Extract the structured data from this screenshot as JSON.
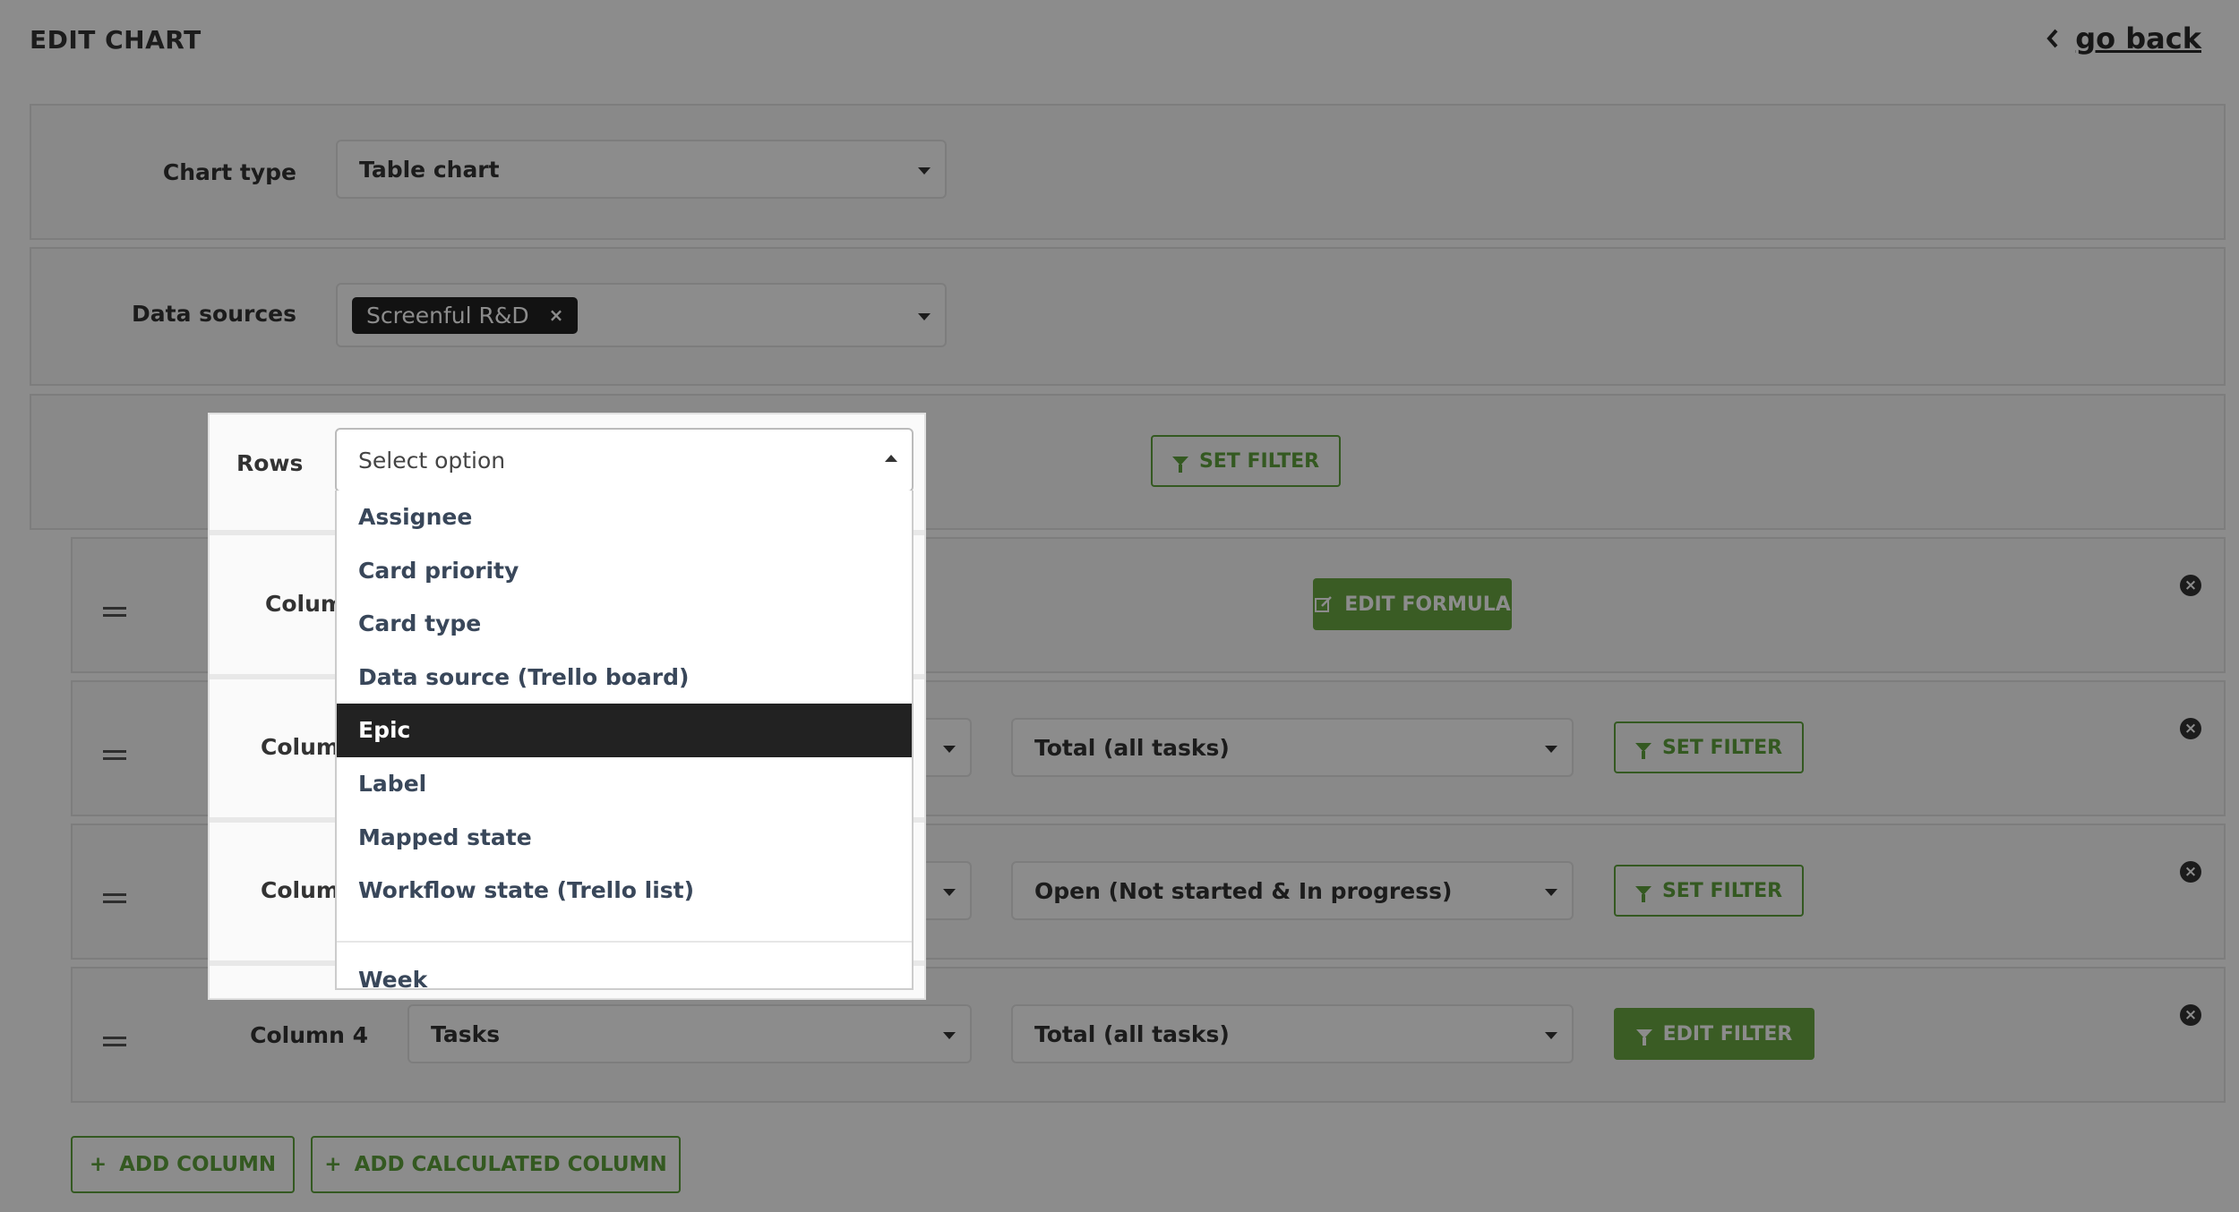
{
  "header": {
    "title": "EDIT CHART",
    "go_back": "go back"
  },
  "chart_type": {
    "label": "Chart type",
    "value": "Table chart"
  },
  "data_sources": {
    "label": "Data sources",
    "tag": "Screenful R&D",
    "tag_remove": "×"
  },
  "rows": {
    "label": "Rows",
    "placeholder": "Select option",
    "set_filter": "SET FILTER",
    "options": [
      "Assignee",
      "Card priority",
      "Card type",
      "Data source (Trello board)",
      "Epic",
      "Label",
      "Mapped state",
      "Workflow state (Trello list)",
      "Week"
    ],
    "highlighted": "Epic"
  },
  "columns": [
    {
      "label": "Colum",
      "action": "EDIT FORMULA",
      "remove": "×"
    },
    {
      "label": "Colum",
      "metric": "Total (all tasks)",
      "action": "SET FILTER",
      "remove": "×"
    },
    {
      "label": "Colum",
      "metric": "Open (Not started & In progress)",
      "action": "SET FILTER",
      "remove": "×"
    },
    {
      "label": "Column 4",
      "source": "Tasks",
      "metric": "Total (all tasks)",
      "action": "EDIT FILTER",
      "remove": "×"
    }
  ],
  "footer": {
    "add_column": "ADD COLUMN",
    "add_calculated_column": "ADD CALCULATED COLUMN",
    "plus": "+"
  },
  "colors": {
    "accent": "#5fa33d",
    "overlay": "rgba(0,0,0,0.45)",
    "active_option": "#222222"
  }
}
